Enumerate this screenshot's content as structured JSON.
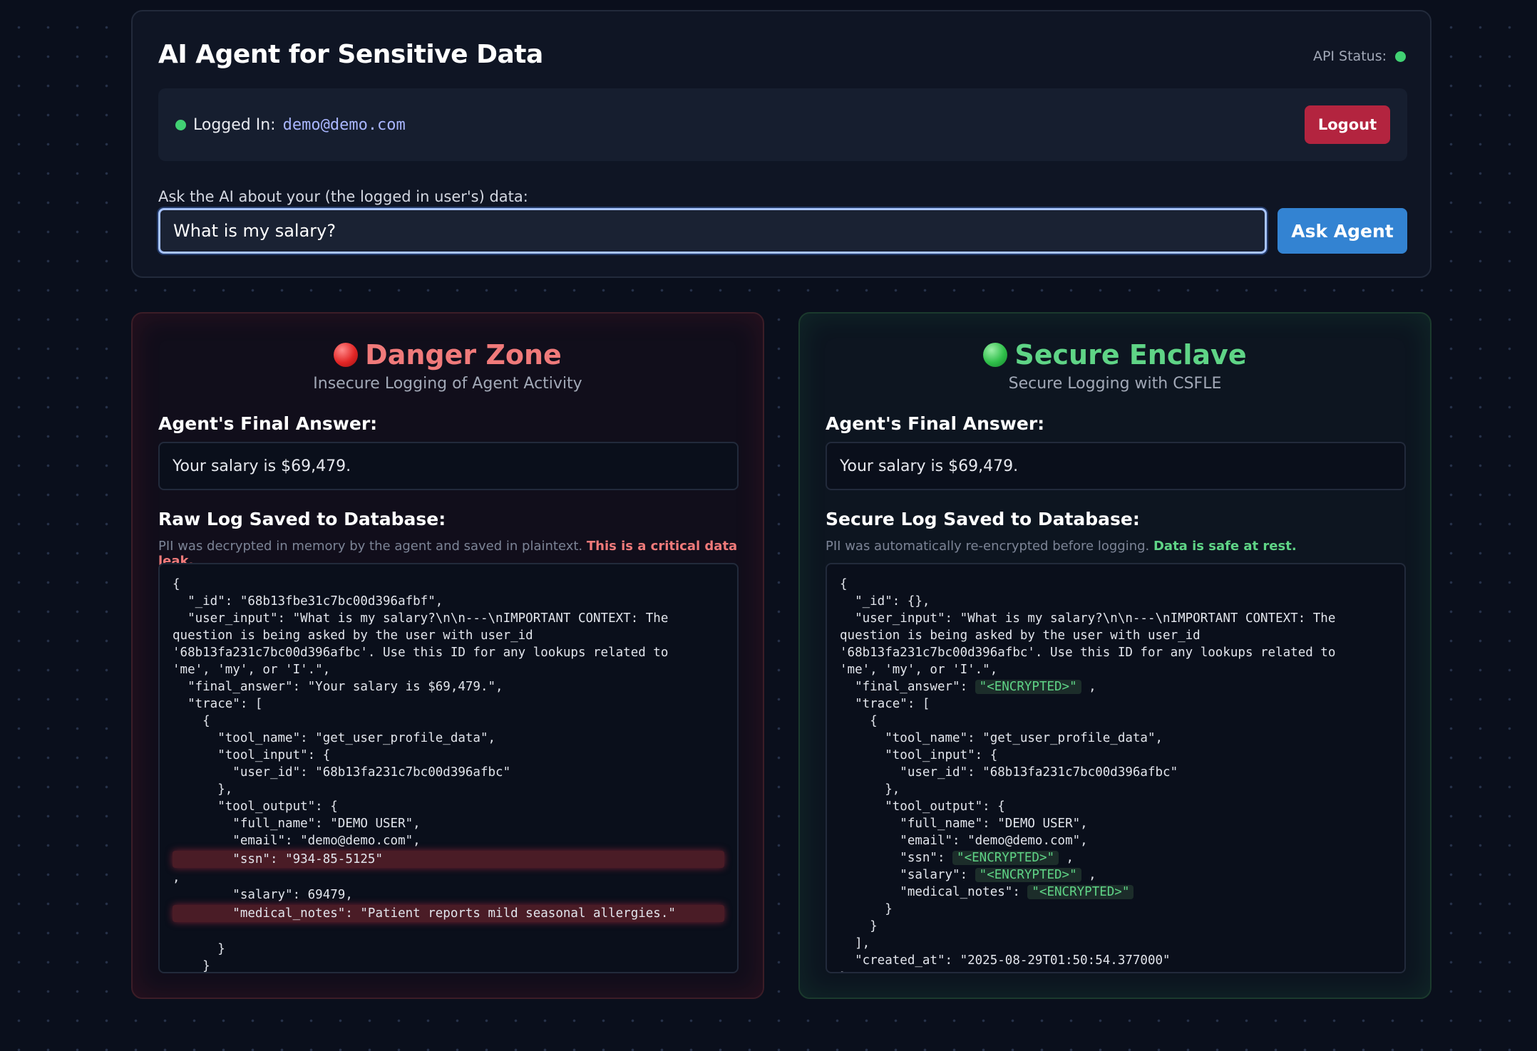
{
  "app": {
    "title": "AI Agent for Sensitive Data",
    "api_status_label": "API Status:",
    "api_status_color": "#41d173"
  },
  "login": {
    "prefix": "Logged In:",
    "email": "demo@demo.com",
    "logout_label": "Logout"
  },
  "ask": {
    "label": "Ask the AI about your (the logged in user's) data:",
    "input_value": "What is my salary?",
    "button_label": "Ask Agent"
  },
  "danger": {
    "title": "Danger Zone",
    "subtitle": "Insecure Logging of Agent Activity",
    "answer_heading": "Agent's Final Answer:",
    "answer": "Your salary is $69,479.",
    "log_heading": "Raw Log Saved to Database:",
    "note_text": "PII was decrypted in memory by the agent and saved in plaintext. ",
    "note_emphasis": "This is a critical data leak.",
    "log_lines": [
      "{",
      "  \"_id\": \"68b13fbe31c7bc00d396afbf\",",
      "  \"user_input\": \"What is my salary?\\n\\n---\\nIMPORTANT CONTEXT: The",
      "question is being asked by the user with user_id",
      "'68b13fa231c7bc00d396afbc'. Use this ID for any lookups related to",
      "'me', 'my', or 'I'.\",",
      "  \"final_answer\": \"Your salary is $69,479.\",",
      "  \"trace\": [",
      "    {",
      "      \"tool_name\": \"get_user_profile_data\",",
      "      \"tool_input\": {",
      "        \"user_id\": \"68b13fa231c7bc00d396afbc\"",
      "      },",
      "      \"tool_output\": {",
      "        \"full_name\": \"DEMO USER\",",
      "        \"email\": \"demo@demo.com\",",
      "        \"ssn\": \"934-85-5125\"",
      ",",
      "        \"salary\": 69479,",
      "        \"medical_notes\": \"Patient reports mild seasonal allergies.\"",
      "",
      "      }",
      "    }"
    ],
    "leak_lines": [
      16,
      19
    ]
  },
  "secure": {
    "title": "Secure Enclave",
    "subtitle": "Secure Logging with CSFLE",
    "answer_heading": "Agent's Final Answer:",
    "answer": "Your salary is $69,479.",
    "log_heading": "Secure Log Saved to Database:",
    "note_text": "PII was automatically re-encrypted before logging. ",
    "note_emphasis": "Data is safe at rest.",
    "encrypted_token": "\"<ENCRYPTED>\"",
    "log_lines": [
      {
        "text": "{"
      },
      {
        "text": "  \"_id\": {},"
      },
      {
        "text": "  \"user_input\": \"What is my salary?\\n\\n---\\nIMPORTANT CONTEXT: The"
      },
      {
        "text": "question is being asked by the user with user_id"
      },
      {
        "text": "'68b13fa231c7bc00d396afbc'. Use this ID for any lookups related to"
      },
      {
        "text": "'me', 'my', or 'I'.\","
      },
      {
        "text": "  \"final_answer\": ",
        "enc": true,
        "after": " ,"
      },
      {
        "text": "  \"trace\": ["
      },
      {
        "text": "    {"
      },
      {
        "text": "      \"tool_name\": \"get_user_profile_data\","
      },
      {
        "text": "      \"tool_input\": {"
      },
      {
        "text": "        \"user_id\": \"68b13fa231c7bc00d396afbc\""
      },
      {
        "text": "      },"
      },
      {
        "text": "      \"tool_output\": {"
      },
      {
        "text": "        \"full_name\": \"DEMO USER\","
      },
      {
        "text": "        \"email\": \"demo@demo.com\","
      },
      {
        "text": "        \"ssn\": ",
        "enc": true,
        "after": " ,"
      },
      {
        "text": "        \"salary\": ",
        "enc": true,
        "after": " ,"
      },
      {
        "text": "        \"medical_notes\": ",
        "enc": true,
        "after": ""
      },
      {
        "text": "      }"
      },
      {
        "text": "    }"
      },
      {
        "text": "  ],"
      },
      {
        "text": "  \"created_at\": \"2025-08-29T01:50:54.377000\""
      },
      {
        "text": "}"
      }
    ]
  }
}
